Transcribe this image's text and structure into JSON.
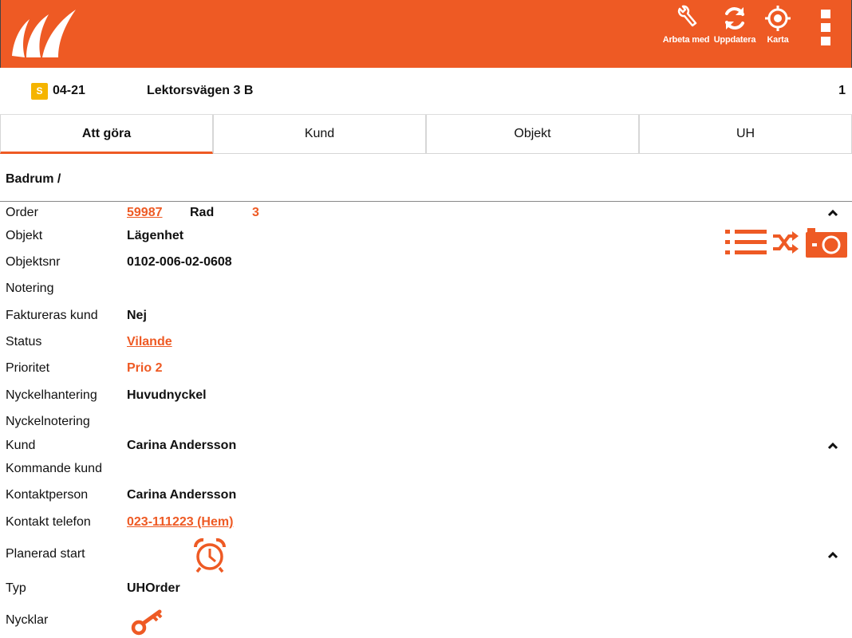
{
  "toolbar": {
    "work_label": "Arbeta med",
    "update_label": "Uppdatera",
    "map_label": "Karta"
  },
  "header": {
    "badge": "S",
    "code": "04-21",
    "address": "Lektorsvägen 3 B",
    "count": "1"
  },
  "tabs": [
    {
      "label": "Att göra",
      "active": true
    },
    {
      "label": "Kund",
      "active": false
    },
    {
      "label": "Objekt",
      "active": false
    },
    {
      "label": "UH",
      "active": false
    }
  ],
  "section": {
    "title": "Badrum /"
  },
  "order": {
    "label": "Order",
    "value": "59987",
    "rad_label": "Rad",
    "rad_value": "3"
  },
  "fields": {
    "objekt": {
      "label": "Objekt",
      "value": "Lägenhet"
    },
    "objektsnr": {
      "label": "Objektsnr",
      "value": "0102-006-02-0608"
    },
    "notering": {
      "label": "Notering",
      "value": ""
    },
    "faktureras": {
      "label": "Faktureras kund",
      "value": "Nej"
    },
    "status": {
      "label": "Status",
      "value": "Vilande"
    },
    "prioritet": {
      "label": "Prioritet",
      "value": "Prio 2"
    },
    "nyckelhantering": {
      "label": "Nyckelhantering",
      "value": "Huvudnyckel"
    },
    "nyckelnotering": {
      "label": "Nyckelnotering",
      "value": ""
    },
    "kund": {
      "label": "Kund",
      "value": "Carina Andersson"
    },
    "kommande_kund": {
      "label": "Kommande kund",
      "value": ""
    },
    "kontaktperson": {
      "label": "Kontaktperson",
      "value": "Carina Andersson"
    },
    "kontakt_telefon": {
      "label": "Kontakt telefon",
      "value": "023-111223 (Hem)"
    },
    "planerad_start": {
      "label": "Planerad start"
    },
    "typ": {
      "label": "Typ",
      "value": "UHOrder"
    },
    "nycklar": {
      "label": "Nycklar"
    }
  },
  "icons": {
    "list": "list-icon",
    "shuffle": "shuffle-icon",
    "camera": "camera-icon",
    "alarm": "alarm-clock-icon",
    "key": "key-icon",
    "wrench": "wrench-icon",
    "refresh": "refresh-icon",
    "crosshair": "crosshair-icon",
    "menu": "kebab-menu-icon"
  },
  "colors": {
    "brand": "#ee5a24",
    "badge": "#f5b400"
  }
}
